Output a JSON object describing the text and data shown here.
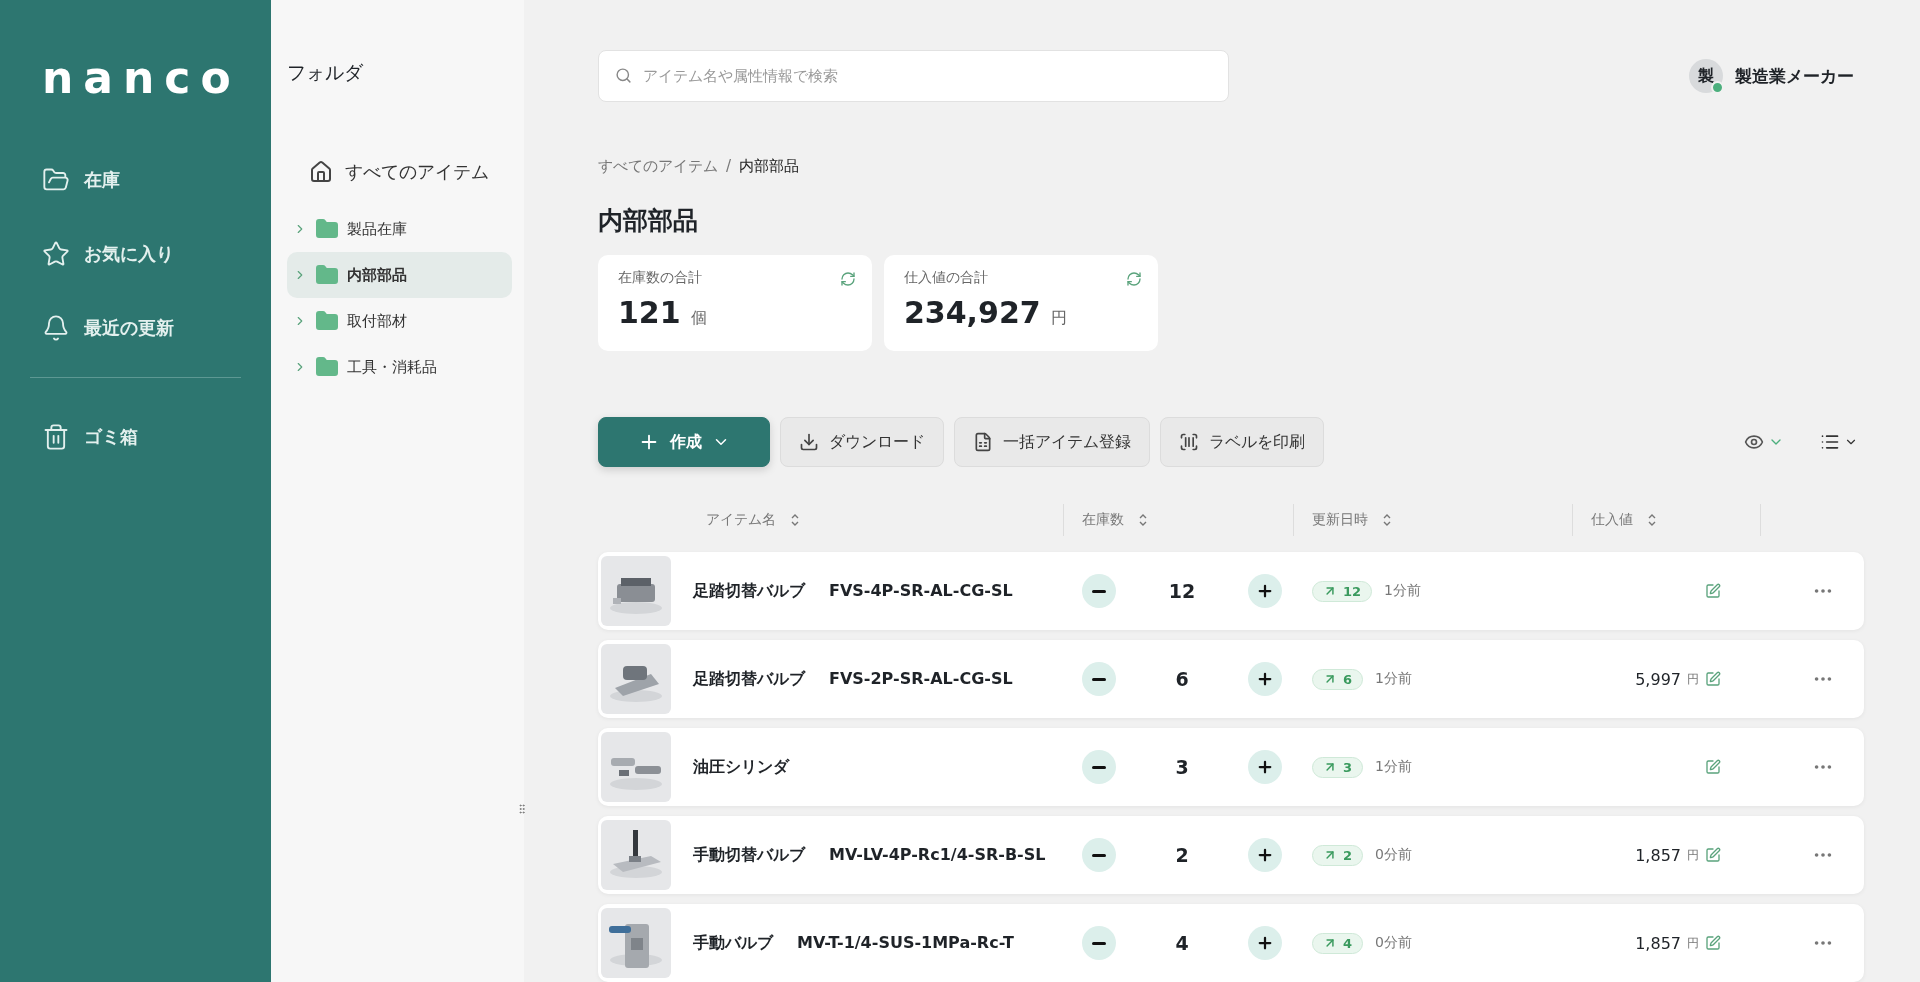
{
  "nav": {
    "logo": "nanco",
    "items": [
      {
        "label": "在庫",
        "kind": "folder"
      },
      {
        "label": "お気に入り",
        "kind": "star"
      },
      {
        "label": "最近の更新",
        "kind": "bell"
      }
    ],
    "footer_items": [
      {
        "label": "ゴミ箱",
        "kind": "trash"
      }
    ]
  },
  "folders": {
    "title": "フォルダ",
    "root": "すべてのアイテム",
    "items": [
      {
        "label": "製品在庫",
        "selected": false,
        "expanded": false
      },
      {
        "label": "内部部品",
        "selected": true,
        "expanded": false
      },
      {
        "label": "取付部材",
        "selected": false,
        "expanded": false
      },
      {
        "label": "工具・消耗品",
        "selected": false,
        "expanded": false
      }
    ]
  },
  "search": {
    "placeholder": "アイテム名や属性情報で検索"
  },
  "user": {
    "avatar": "製",
    "name": "製造業メーカー",
    "online": true
  },
  "breadcrumb": [
    "すべてのアイテム",
    "内部部品"
  ],
  "breadcrumb_separator": "/",
  "title": "内部部品",
  "stats": [
    {
      "label": "在庫数の合計",
      "value": "121",
      "unit": "個"
    },
    {
      "label": "仕入値の合計",
      "value": "234,927",
      "unit": "円"
    }
  ],
  "toolbar": [
    {
      "label": "作成",
      "kind": "primary"
    },
    {
      "label": "ダウンロード",
      "kind": "download"
    },
    {
      "label": "一括アイテム登録",
      "kind": "sheet"
    },
    {
      "label": "ラベルを印刷",
      "kind": "barcode"
    }
  ],
  "table": {
    "columns": [
      "アイテム名",
      "在庫数",
      "更新日時",
      "仕入値"
    ],
    "rows": [
      {
        "name": "足踏切替バルブ",
        "code": "FVS-4P-SR-AL-CG-SL",
        "quantity": "12",
        "change": "12",
        "updated": "1分前"
      },
      {
        "name": "足踏切替バルブ",
        "code": "FVS-2P-SR-AL-CG-SL",
        "quantity": "6",
        "change": "6",
        "updated": "1分前",
        "price": "5,997",
        "currency": "円"
      },
      {
        "name": "油圧シリンダ",
        "quantity": "3",
        "change": "3",
        "updated": "1分前"
      },
      {
        "name": "手動切替バルブ",
        "code": "MV-LV-4P-Rc1/4-SR-B-SL",
        "quantity": "2",
        "change": "2",
        "updated": "0分前",
        "price": "1,857",
        "currency": "円"
      },
      {
        "name": "手動バルブ",
        "code": "MV-T-1/4-SUS-1MPa-Rc-T",
        "quantity": "4",
        "change": "4",
        "updated": "0分前",
        "price": "1,857",
        "currency": "円"
      }
    ]
  }
}
